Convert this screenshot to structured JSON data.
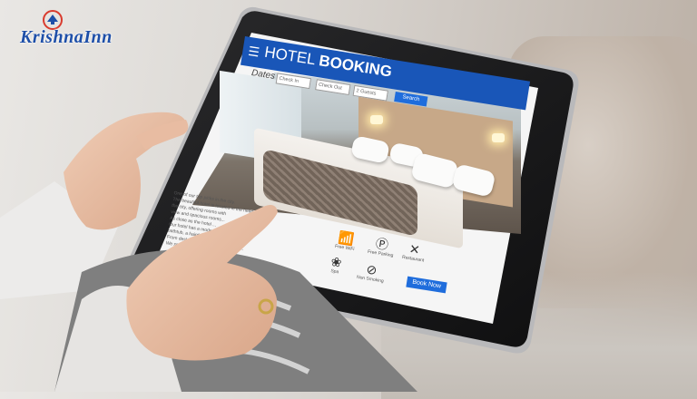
{
  "logo": {
    "text": "KrishnaInn"
  },
  "booking_site": {
    "header": {
      "menu_icon": "hamburger-icon",
      "title_light": "HOTEL",
      "title_bold": "BOOKING"
    },
    "search": {
      "dates_label": "Dates",
      "check_in_placeholder": "Check In",
      "check_out_placeholder": "Check Out",
      "guests_value": "2 Guests",
      "search_label": "Search"
    },
    "description": [
      "One of our top picks in the city.",
      "The beautiful hotel is located in the heart of",
      "the city, offering rooms with",
      "view and spacious rooms...",
      "As close as the hotel ...",
      "Our hotel has a modern bathroom with",
      "bathtub, a hairdryer and",
      "From desk staff is available 24 hours...",
      "We speak your language!"
    ],
    "book_now_label": "Book Now",
    "amenities": [
      {
        "icon": "wifi-icon",
        "label": "Free WiFi"
      },
      {
        "icon": "parking-icon",
        "label": "Free Parking"
      },
      {
        "icon": "restaurant-icon",
        "label": "Restaurant"
      },
      {
        "icon": "spa-icon",
        "label": "Spa"
      },
      {
        "icon": "no-smoking-icon",
        "label": "Non Smoking"
      }
    ]
  },
  "colors": {
    "brand_blue": "#1956b8",
    "button_blue": "#1f6ddc"
  }
}
